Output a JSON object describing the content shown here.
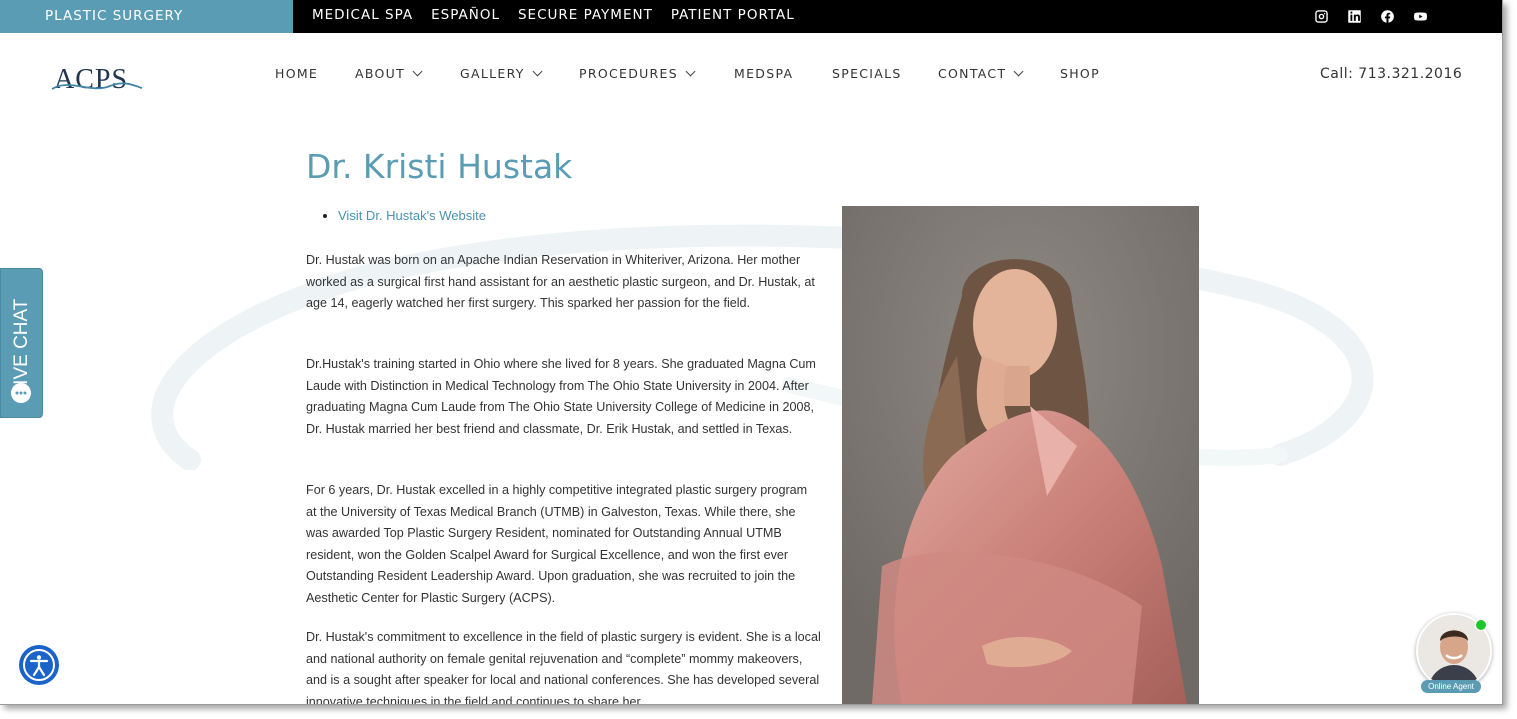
{
  "topbar": {
    "plastic_surgery": "PLASTIC SURGERY",
    "links": [
      "MEDICAL SPA",
      "ESPAÑOL",
      "SECURE PAYMENT",
      "PATIENT PORTAL"
    ],
    "social_icons": [
      "instagram-icon",
      "linkedin-icon",
      "facebook-icon",
      "youtube-icon"
    ]
  },
  "header": {
    "logo_text": "ACPS",
    "nav": [
      {
        "label": "HOME",
        "dropdown": false
      },
      {
        "label": "ABOUT",
        "dropdown": true
      },
      {
        "label": "GALLERY",
        "dropdown": true
      },
      {
        "label": "PROCEDURES",
        "dropdown": true
      },
      {
        "label": "MEDSPA",
        "dropdown": false
      },
      {
        "label": "SPECIALS",
        "dropdown": false
      },
      {
        "label": "CONTACT",
        "dropdown": true
      },
      {
        "label": "SHOP",
        "dropdown": false
      }
    ],
    "call": "Call: 713.321.2016"
  },
  "main": {
    "title": "Dr. Kristi Hustak",
    "website_link": "Visit Dr. Hustak's Website",
    "paragraphs": [
      "Dr. Hustak was born on an Apache Indian Reservation in Whiteriver, Arizona. Her mother worked as a surgical first hand assistant for an aesthetic plastic surgeon, and Dr. Hustak, at age 14, eagerly watched her first surgery. This sparked her passion for the field.",
      "Dr.Hustak's training started in Ohio where she lived for 8 years. She graduated Magna Cum Laude with Distinction in Medical Technology from The Ohio State University in 2004. After graduating Magna Cum Laude from The Ohio State University College of Medicine in 2008, Dr. Hustak married her best friend and classmate, Dr. Erik Hustak, and settled in Texas.",
      "For 6 years, Dr. Hustak excelled in a highly competitive integrated plastic surgery program at the University of Texas Medical Branch (UTMB) in Galveston, Texas. While there, she was awarded Top Plastic Surgery Resident, nominated for Outstanding Annual UTMB resident, won the Golden Scalpel Award for Surgical Excellence, and won the first ever Outstanding Resident Leadership Award. Upon graduation, she was recruited to join the Aesthetic Center for Plastic Surgery (ACPS).",
      "Dr. Hustak's commitment to excellence in the field of plastic surgery is evident. She is a local and national authority on female genital rejuvenation and “complete” mommy makeovers, and is a sought after speaker for local and national conferences. She has developed several innovative techniques in the field and continues to share her"
    ]
  },
  "widgets": {
    "live_chat": "LIVE CHAT",
    "online_agent": "Online Agent",
    "accessibility_icon": "accessibility-icon"
  },
  "colors": {
    "accent": "#5b9cb5",
    "topbar": "#000000",
    "link": "#4a92ae",
    "accessibility": "#1a63c9",
    "online": "#1ec82c"
  }
}
